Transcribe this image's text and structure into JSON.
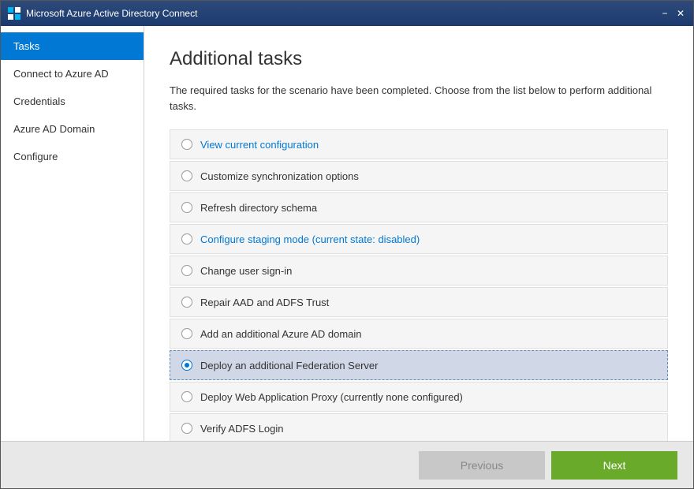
{
  "titleBar": {
    "title": "Microsoft Azure Active Directory Connect",
    "minimizeLabel": "−",
    "closeLabel": "✕"
  },
  "sidebar": {
    "items": [
      {
        "id": "tasks",
        "label": "Tasks",
        "active": true
      },
      {
        "id": "connect",
        "label": "Connect to Azure AD",
        "active": false
      },
      {
        "id": "credentials",
        "label": "Credentials",
        "active": false
      },
      {
        "id": "domain",
        "label": "Azure AD Domain",
        "active": false
      },
      {
        "id": "configure",
        "label": "Configure",
        "active": false
      }
    ]
  },
  "content": {
    "title": "Additional tasks",
    "description": "The required tasks for the scenario have been completed. Choose from the list below to perform additional tasks.",
    "tasks": [
      {
        "id": "view-config",
        "label": "View current configuration",
        "linkStyle": true,
        "selected": false
      },
      {
        "id": "customize-sync",
        "label": "Customize synchronization options",
        "linkStyle": false,
        "selected": false
      },
      {
        "id": "refresh-schema",
        "label": "Refresh directory schema",
        "linkStyle": false,
        "selected": false
      },
      {
        "id": "staging-mode",
        "label": "Configure staging mode (current state: disabled)",
        "linkStyle": true,
        "selected": false
      },
      {
        "id": "change-signin",
        "label": "Change user sign-in",
        "linkStyle": false,
        "selected": false
      },
      {
        "id": "repair-aad",
        "label": "Repair AAD and ADFS Trust",
        "linkStyle": false,
        "selected": false
      },
      {
        "id": "add-azure-domain",
        "label": "Add an additional Azure AD domain",
        "linkStyle": false,
        "selected": false
      },
      {
        "id": "deploy-federation",
        "label": "Deploy an additional Federation Server",
        "linkStyle": false,
        "selected": true
      },
      {
        "id": "deploy-proxy",
        "label": "Deploy Web Application Proxy (currently none configured)",
        "linkStyle": false,
        "selected": false
      },
      {
        "id": "verify-adfs",
        "label": "Verify ADFS Login",
        "linkStyle": false,
        "selected": false
      }
    ]
  },
  "footer": {
    "previousLabel": "Previous",
    "nextLabel": "Next"
  }
}
